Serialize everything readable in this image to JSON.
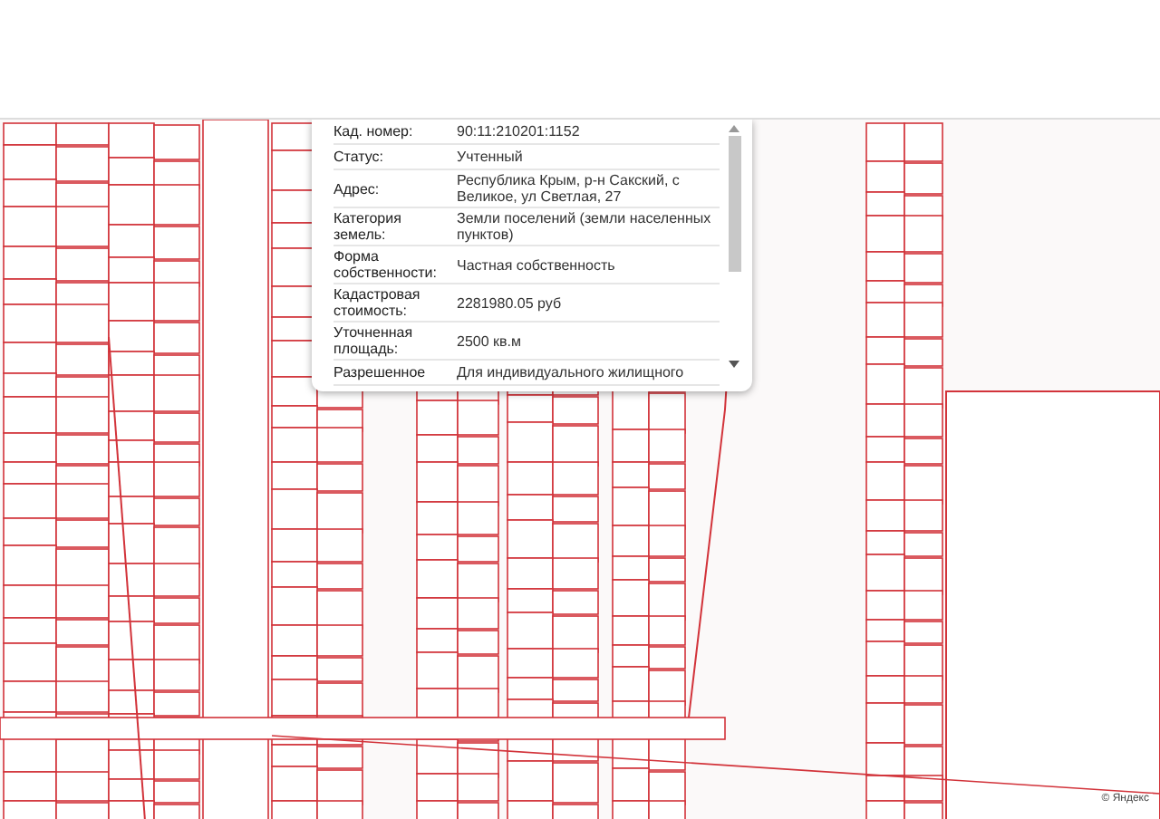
{
  "popup": {
    "rows": [
      {
        "label": "Кад. номер:",
        "value": "90:11:210201:1152"
      },
      {
        "label": "Статус:",
        "value": "Учтенный"
      },
      {
        "label": "Адрес:",
        "value": "Республика Крым, р-н Сакский, с Великое, ул Светлая, 27"
      },
      {
        "label": "Категория земель:",
        "value": "Земли поселений (земли населенных пунктов)"
      },
      {
        "label": "Форма собственности:",
        "value": "Частная собственность"
      },
      {
        "label": "Кадастровая стоимость:",
        "value": "2281980.05 руб"
      },
      {
        "label": "Уточненная площадь:",
        "value": "2500 кв.м"
      },
      {
        "label": "Разрешенное",
        "value": "Для индивидуального жилищного"
      }
    ]
  },
  "map": {
    "attribution": "© Яндекс"
  }
}
